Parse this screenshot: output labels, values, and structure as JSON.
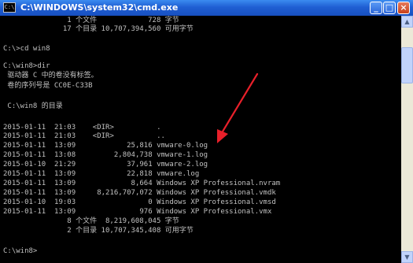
{
  "window": {
    "title": "C:\\WINDOWS\\system32\\cmd.exe",
    "icon_label": "C:\\",
    "minimize_label": "_",
    "maximize_label": "□",
    "close_label": "×"
  },
  "console": {
    "lines": [
      "               1 个文件            728 字节",
      "              17 个目录 10,707,394,560 可用字节",
      "",
      "C:\\>cd win8",
      "",
      "C:\\win8>dir",
      " 驱动器 C 中的卷没有标签。",
      " 卷的序列号是 CC0E-C33B",
      "",
      " C:\\win8 的目录",
      "",
      "2015-01-11  21:03    <DIR>          .",
      "2015-01-11  21:03    <DIR>          ..",
      "2015-01-11  13:09            25,816 vmware-0.log",
      "2015-01-11  13:08         2,804,738 vmware-1.log",
      "2015-01-10  21:29            37,961 vmware-2.log",
      "2015-01-11  13:09            22,818 vmware.log",
      "2015-01-11  13:09             8,664 Windows XP Professional.nvram",
      "2015-01-11  13:09     8,216,707,072 Windows XP Professional.vmdk",
      "2015-01-10  19:03                 0 Windows XP Professional.vmsd",
      "2015-01-11  13:09               976 Windows XP Professional.vmx",
      "               8 个文件  8,219,608,045 字节",
      "               2 个目录 10,707,345,408 可用字节",
      "",
      "C:\\win8>"
    ]
  },
  "annotation": {
    "arrow_color": "#e8202a"
  },
  "scrollbar": {
    "up_label": "▲",
    "down_label": "▼"
  }
}
